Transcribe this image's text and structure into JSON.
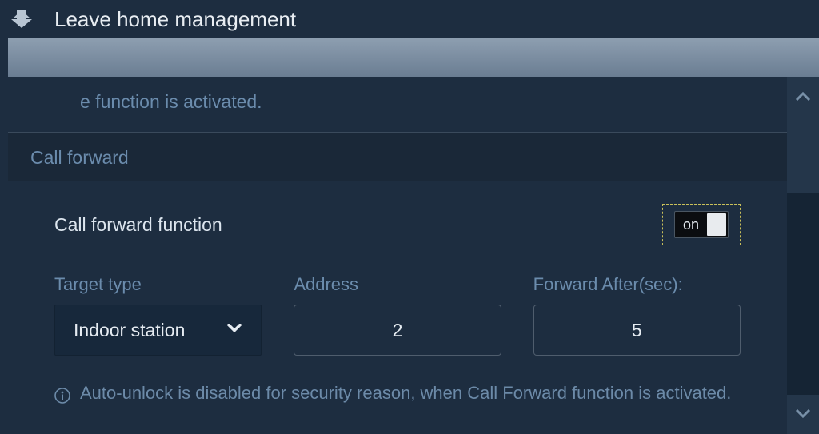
{
  "header": {
    "title": "Leave home management"
  },
  "partialRow": {
    "tail": "e function is activated."
  },
  "section": {
    "title": "Call forward",
    "toggle": {
      "label": "Call forward function",
      "state_text": "on"
    },
    "fields": {
      "target": {
        "label": "Target type",
        "value": "Indoor station"
      },
      "address": {
        "label": "Address",
        "value": "2"
      },
      "forwardAfter": {
        "label": "Forward After(sec):",
        "value": "5"
      }
    },
    "info": "Auto-unlock is disabled for security reason, when Call Forward function is activated."
  }
}
